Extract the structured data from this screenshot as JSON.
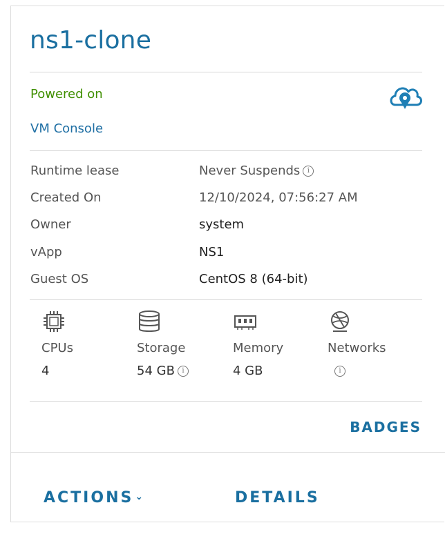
{
  "vm": {
    "name": "ns1-clone",
    "status": "Powered on",
    "console_link": "VM Console",
    "status_color": "#3f8f00",
    "accent_color": "#1a6fa0"
  },
  "properties": {
    "runtime_lease": {
      "label": "Runtime lease",
      "value": "Never Suspends"
    },
    "created_on": {
      "label": "Created On",
      "value": "12/10/2024, 07:56:27 AM"
    },
    "owner": {
      "label": "Owner",
      "value": "system"
    },
    "vapp": {
      "label": "vApp",
      "value": "NS1"
    },
    "guest_os": {
      "label": "Guest OS",
      "value": "CentOS 8 (64-bit)"
    }
  },
  "resources": {
    "cpus": {
      "label": "CPUs",
      "value": "4",
      "icon": "cpu-icon"
    },
    "storage": {
      "label": "Storage",
      "value": "54 GB",
      "icon": "storage-icon"
    },
    "memory": {
      "label": "Memory",
      "value": "4 GB",
      "icon": "memory-icon"
    },
    "networks": {
      "label": "Networks",
      "value": "",
      "icon": "network-icon"
    }
  },
  "actions": {
    "badges": "BADGES",
    "actions": "ACTIONS",
    "details": "DETAILS"
  },
  "icons": {
    "info": "i",
    "chevron": "⌄"
  }
}
